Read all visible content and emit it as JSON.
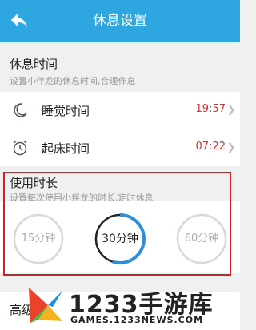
{
  "header": {
    "title": "休息设置"
  },
  "rest_time": {
    "title": "休息时间",
    "subtitle": "设置小伴龙的休息时间,合理作息",
    "rows": [
      {
        "label": "睡觉时间",
        "value": "19:57",
        "icon": "moon-icon"
      },
      {
        "label": "起床时间",
        "value": "07:22",
        "icon": "alarm-clock-icon"
      }
    ]
  },
  "usage": {
    "title": "使用时长",
    "subtitle": "设置每次使用小伴龙的时长,定时休息",
    "options": [
      {
        "label": "15分钟",
        "selected": false
      },
      {
        "label": "30分钟",
        "selected": true,
        "progress": 0.55
      },
      {
        "label": "60分钟",
        "selected": false
      }
    ]
  },
  "advanced": {
    "label": "高级设"
  },
  "watermark": {
    "text": "1233手游库",
    "url": "GAMES.1233NEWS.COM"
  },
  "colors": {
    "header": "#2ea7e0",
    "time_value": "#d0312d",
    "highlight_border": "#d42020",
    "ring_selected": "#2e8fd8",
    "ring_idle": "#d8d8d8"
  }
}
